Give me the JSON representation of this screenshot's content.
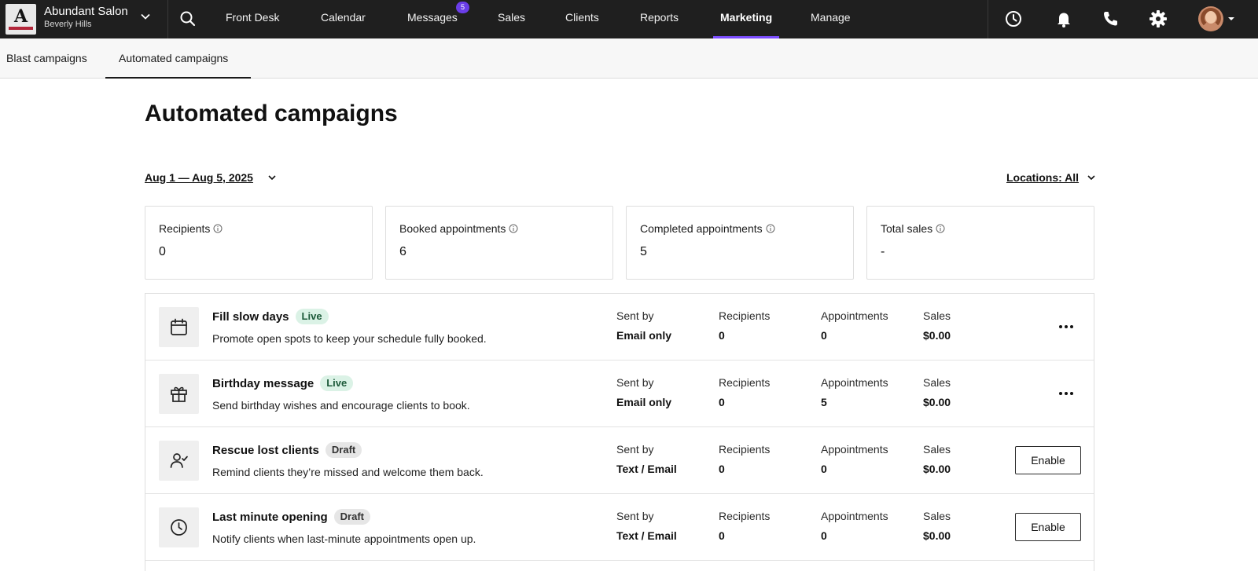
{
  "brand": {
    "name": "Abundant Salon",
    "location": "Beverly Hills",
    "logo_letter": "A"
  },
  "nav": {
    "items": [
      {
        "label": "Front Desk"
      },
      {
        "label": "Calendar"
      },
      {
        "label": "Messages",
        "badge": "5"
      },
      {
        "label": "Sales"
      },
      {
        "label": "Clients"
      },
      {
        "label": "Reports"
      },
      {
        "label": "Marketing",
        "active": true
      },
      {
        "label": "Manage"
      }
    ]
  },
  "utility_icons": [
    "search-icon",
    "clock-icon",
    "bell-icon",
    "phone-icon",
    "gear-icon",
    "avatar"
  ],
  "subtabs": [
    {
      "label": "Blast campaigns"
    },
    {
      "label": "Automated campaigns",
      "active": true
    }
  ],
  "page": {
    "title": "Automated campaigns",
    "date_range": "Aug 1 — Aug 5, 2025",
    "locations": "Locations: All"
  },
  "stats": [
    {
      "label": "Recipients",
      "value": "0"
    },
    {
      "label": "Booked appointments",
      "value": "6"
    },
    {
      "label": "Completed appointments",
      "value": "5"
    },
    {
      "label": "Total sales",
      "value": "-"
    }
  ],
  "columns": {
    "sent_by": "Sent by",
    "recipients": "Recipients",
    "appointments": "Appointments",
    "sales": "Sales"
  },
  "campaigns": [
    {
      "icon": "calendar-icon",
      "title": "Fill slow days",
      "status": "Live",
      "description": "Promote open spots to keep your schedule fully booked.",
      "sent_by": "Email only",
      "recipients": "0",
      "appointments": "0",
      "sales": "$0.00",
      "action": "more"
    },
    {
      "icon": "gift-icon",
      "title": "Birthday message",
      "status": "Live",
      "description": "Send birthday wishes and encourage clients to book.",
      "sent_by": "Email only",
      "recipients": "0",
      "appointments": "5",
      "sales": "$0.00",
      "action": "more"
    },
    {
      "icon": "user-check-icon",
      "title": "Rescue lost clients",
      "status": "Draft",
      "description": "Remind clients they’re missed and welcome them back.",
      "sent_by": "Text / Email",
      "recipients": "0",
      "appointments": "0",
      "sales": "$0.00",
      "action": "Enable"
    },
    {
      "icon": "clock-icon",
      "title": "Last minute opening",
      "status": "Draft",
      "description": "Notify clients when last-minute appointments open up.",
      "sent_by": "Text / Email",
      "recipients": "0",
      "appointments": "0",
      "sales": "$0.00",
      "action": "Enable"
    }
  ],
  "colors": {
    "topbar": "#1f1f1f",
    "accent": "#7c4dff",
    "badge": "#6a3de8",
    "live_bg": "#dbf2e6",
    "draft_bg": "#e6e6e6"
  }
}
